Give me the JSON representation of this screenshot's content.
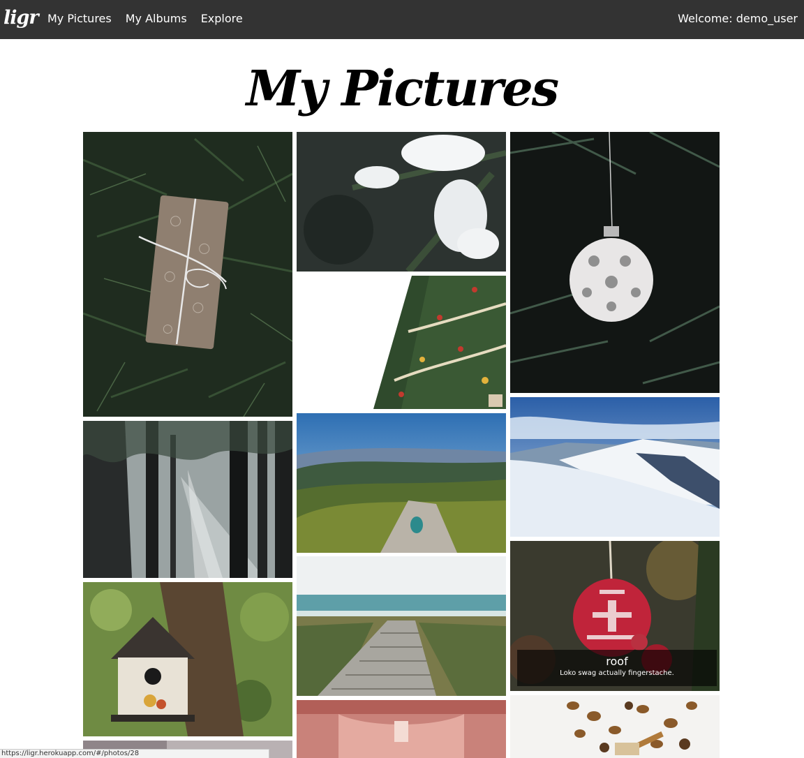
{
  "navbar": {
    "logo": "ligr",
    "links": [
      "My Pictures",
      "My Albums",
      "Explore"
    ],
    "welcome": "Welcome: demo_user"
  },
  "page": {
    "title": "My Pictures"
  },
  "gallery": {
    "hover_caption": {
      "title": "roof",
      "description": "Loko swag actually fingerstache."
    }
  },
  "status_bar": {
    "url": "https://ligr.herokuapp.com/#/photos/28"
  },
  "colors": {
    "navbar_bg": "#333333",
    "page_bg": "#ffffff"
  }
}
